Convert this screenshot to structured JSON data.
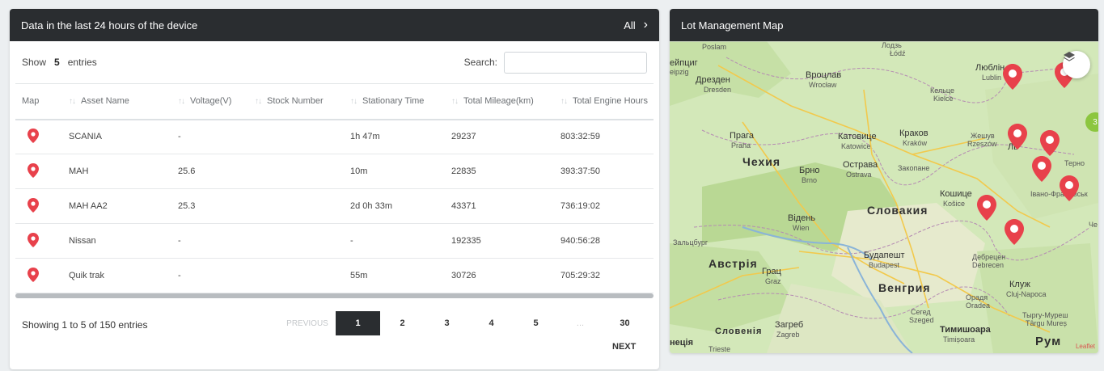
{
  "left_panel": {
    "title": "Data in the last 24 hours of the device",
    "all_label": "All",
    "show_label": "Show",
    "show_count": "5",
    "entries_label": "entries",
    "search_label": "Search:",
    "search_value": "",
    "columns": [
      "Map",
      "Asset Name",
      "Voltage(V)",
      "Stock Number",
      "Stationary Time",
      "Total Mileage(km)",
      "Total Engine Hours"
    ],
    "rows": [
      {
        "asset": "SCANIA",
        "voltage": "-",
        "stock": "",
        "stationary": "1h 47m",
        "mileage": "29237",
        "engine": "803:32:59"
      },
      {
        "asset": "MAH",
        "voltage": "25.6",
        "stock": "",
        "stationary": "10m",
        "mileage": "22835",
        "engine": "393:37:50"
      },
      {
        "asset": "MAH AA2",
        "voltage": "25.3",
        "stock": "",
        "stationary": "2d 0h 33m",
        "mileage": "43371",
        "engine": "736:19:02"
      },
      {
        "asset": "Nissan",
        "voltage": "-",
        "stock": "",
        "stationary": "-",
        "mileage": "192335",
        "engine": "940:56:28"
      },
      {
        "asset": "Quik trak",
        "voltage": "-",
        "stock": "",
        "stationary": "55m",
        "mileage": "30726",
        "engine": "705:29:32"
      }
    ],
    "info": "Showing 1 to 5 of 150 entries",
    "pager": {
      "prev": "PREVIOUS",
      "pages": [
        "1",
        "2",
        "3",
        "4",
        "5",
        "...",
        "30"
      ],
      "next": "NEXT",
      "active": "1"
    }
  },
  "right_panel": {
    "title": "Lot Management Map",
    "cluster_count": "3",
    "attribution": "Leaflet",
    "labels": {
      "lodz": "Лодзь",
      "lodz2": "Łódź",
      "dresden": "Дрезден",
      "dresden2": "Dresden",
      "wroclaw": "Вроцлав",
      "wroclaw2": "Wrocław",
      "kielce": "Кельце",
      "kielce2": "Kielce",
      "lublin": "Люблін",
      "lublin2": "Lublin",
      "praha": "Прага",
      "praha2": "Praha",
      "katowice": "Катовице",
      "katowice2": "Katowice",
      "krakow": "Краков",
      "krakow2": "Kraków",
      "rzeszow": "Жешув",
      "rzeszow2": "Rzeszów",
      "czechia": "Чехия",
      "brno": "Брно",
      "brno2": "Brno",
      "ostrava": "Острава",
      "ostrava2": "Ostrava",
      "zakopane": "Закопане",
      "kosice": "Кошице",
      "kosice2": "Košice",
      "slovakia": "Словакия",
      "vienna": "Відень",
      "vienna2": "Wien",
      "salzburg": "Зальцбург",
      "austria": "Австрія",
      "graz": "Грац",
      "graz2": "Graz",
      "budapest": "Будапешт",
      "budapest2": "Budapest",
      "debrecen": "Дебрецен",
      "debrecen2": "Debrecen",
      "hungary": "Венгрия",
      "cluj": "Клуж",
      "cluj2": "Cluj-Napoca",
      "oradea": "Орадя",
      "oradea2": "Oradea",
      "szeged": "Сегед",
      "szeged2": "Szeged",
      "slovenia": "Словенія",
      "zagreb": "Загреб",
      "zagreb2": "Zagreb",
      "timisoara": "Тимишоара",
      "timisoara2": "Timișoara",
      "tirgu": "Тыргу-Муреш",
      "tirgu2": "Târgu Mureș",
      "ivano": "Івано-Франківськ",
      "ternopil": "Терно",
      "lviv": "Ль",
      "trieste": "Trieste",
      "rum": "Рум",
      "italy": "неція",
      "chem": "Че",
      "cypr": "Острава",
      "leipzig": "ейпциг",
      "leipzig2": "eipzig",
      "posl": "Poslam"
    }
  }
}
